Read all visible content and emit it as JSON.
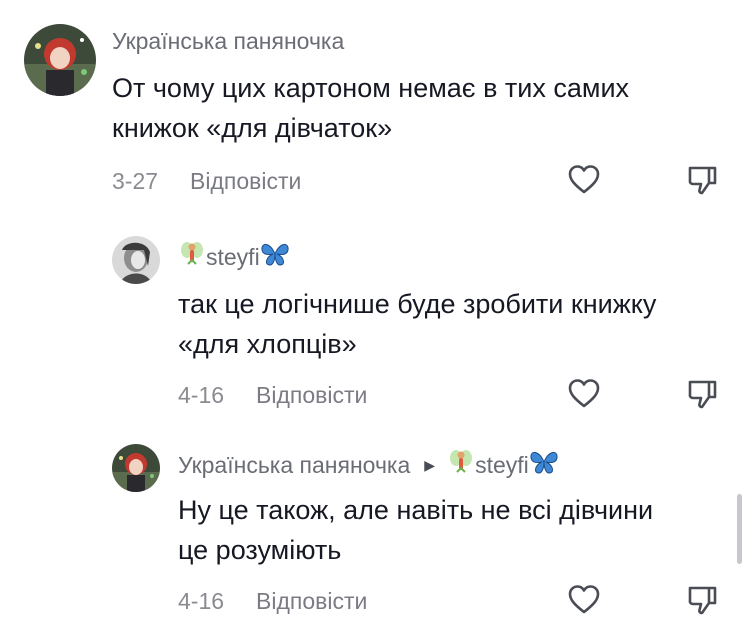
{
  "comments": [
    {
      "username": "Українська паняночка",
      "text_line1": "От чому цих картоном немає в тих самих",
      "text_line2": "книжок «для дівчаток»",
      "date": "3-27",
      "reply_label": "Відповісти"
    },
    {
      "username": "steyfi",
      "text_line1": "так це логічнише буде зробити книжку",
      "text_line2": "«для хлопців»",
      "date": "4-16",
      "reply_label": "Відповісти"
    },
    {
      "username": "Українська паняночка",
      "reply_to": "steyfi",
      "text_line1": "Ну це також, але навіть не всі дівчини",
      "text_line2": "це розуміють",
      "date": "4-16",
      "reply_label": "Відповісти"
    }
  ],
  "icons": {
    "like": "heart-outline-icon",
    "dislike": "thumbs-down-outline-icon",
    "fairy": "fairy-emoji",
    "butterfly": "butterfly-emoji",
    "reply_arrow": "caret-right-icon"
  }
}
